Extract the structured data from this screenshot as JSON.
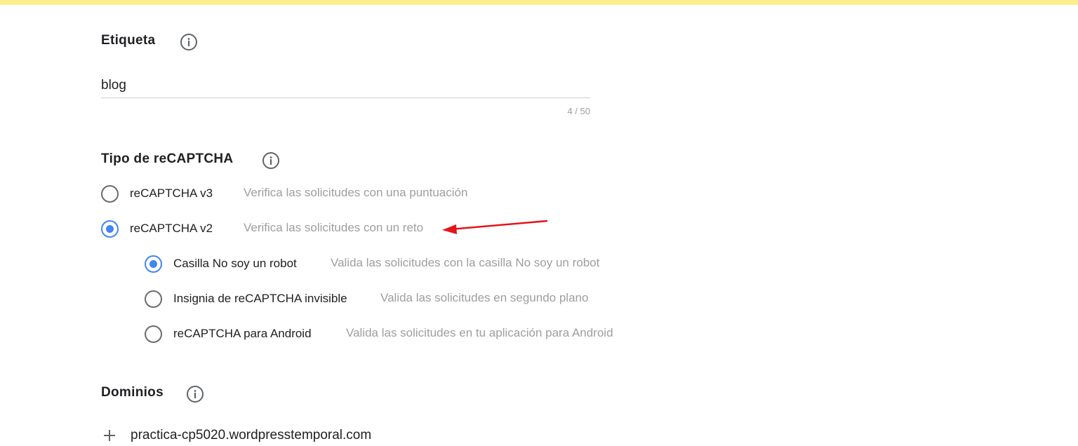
{
  "colors": {
    "top_bar": "#fdee8d",
    "accent": "#4285f4",
    "arrow": "#e3141c"
  },
  "label_section": {
    "title": "Etiqueta",
    "info_icon": "info-icon",
    "input_value": "blog",
    "counter": "4 / 50"
  },
  "type_section": {
    "title": "Tipo de reCAPTCHA",
    "info_icon": "info-icon",
    "options": [
      {
        "label": "reCAPTCHA v3",
        "description": "Verifica las solicitudes con una puntuación",
        "checked": false
      },
      {
        "label": "reCAPTCHA v2",
        "description": "Verifica las solicitudes con un reto",
        "checked": true
      }
    ],
    "v2_options": [
      {
        "label": "Casilla No soy un robot",
        "description": "Valida las solicitudes con la casilla No soy un robot",
        "checked": true
      },
      {
        "label": "Insignia de reCAPTCHA invisible",
        "description": "Valida las solicitudes en segundo plano",
        "checked": false
      },
      {
        "label": "reCAPTCHA para Android",
        "description": "Valida las solicitudes en tu aplicación para Android",
        "checked": false
      }
    ]
  },
  "domains_section": {
    "title": "Dominios",
    "info_icon": "info-icon",
    "add_icon": "plus-icon",
    "domain": "practica-cp5020.wordpresstemporal.com"
  }
}
